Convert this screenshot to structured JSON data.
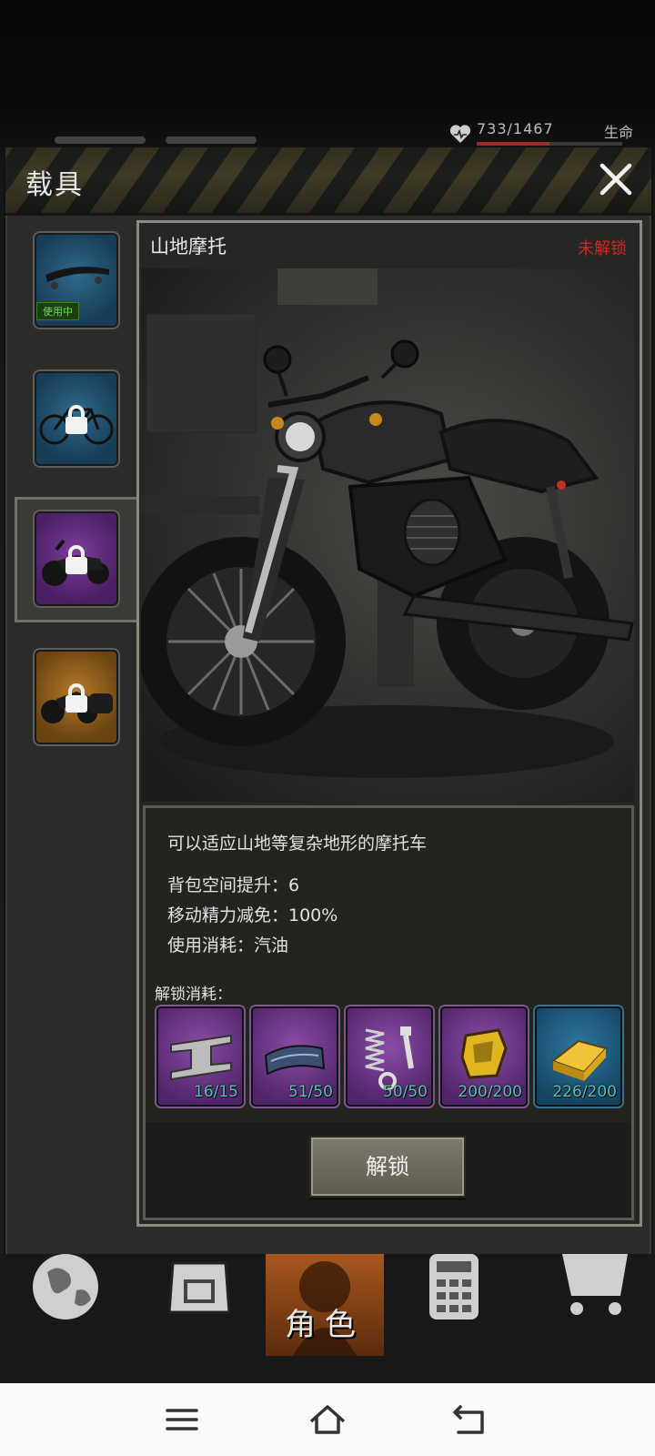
{
  "hud": {
    "hp_text": "733/1467",
    "hp_current": 733,
    "hp_max": 1467,
    "hp_label": "生命",
    "hp_color": "#a02a2a"
  },
  "dialog": {
    "title": "载具",
    "close_icon": "close-icon"
  },
  "sidebar": {
    "vehicles": [
      {
        "icon": "skateboard-icon",
        "rarity": "blue",
        "tag": "使用中",
        "locked": false
      },
      {
        "icon": "bicycle-icon",
        "rarity": "blue",
        "locked": true
      },
      {
        "icon": "motorcycle-icon",
        "rarity": "purple",
        "locked": true,
        "selected": true
      },
      {
        "icon": "sidecar-motorcycle-icon",
        "rarity": "orange",
        "locked": true
      }
    ]
  },
  "vehicle": {
    "name": "山地摩托",
    "status": "未解锁",
    "status_color": "#d2261f",
    "description": "可以适应山地等复杂地形的摩托车",
    "stats": [
      "背包空间提升：6",
      "移动精力减免：100%",
      "使用消耗：汽油"
    ]
  },
  "cost": {
    "label": "解锁消耗：",
    "items": [
      {
        "icon": "steel-beam-icon",
        "count": "16/15",
        "rarity": "purple"
      },
      {
        "icon": "rubber-sheet-icon",
        "count": "51/50",
        "rarity": "purple"
      },
      {
        "icon": "spring-bolt-icon",
        "count": "50/50",
        "rarity": "purple"
      },
      {
        "icon": "gold-nugget-icon",
        "count": "200/200",
        "rarity": "purple"
      },
      {
        "icon": "gold-bar-icon",
        "count": "226/200",
        "rarity": "blue"
      }
    ]
  },
  "unlock_button": "解锁",
  "game_nav": {
    "items": [
      "globe-icon",
      "backpack-icon",
      "character-icon",
      "calculator-icon",
      "cart-icon"
    ],
    "role_label": "角色"
  },
  "system_nav": [
    "menu-icon",
    "home-icon",
    "back-icon"
  ]
}
